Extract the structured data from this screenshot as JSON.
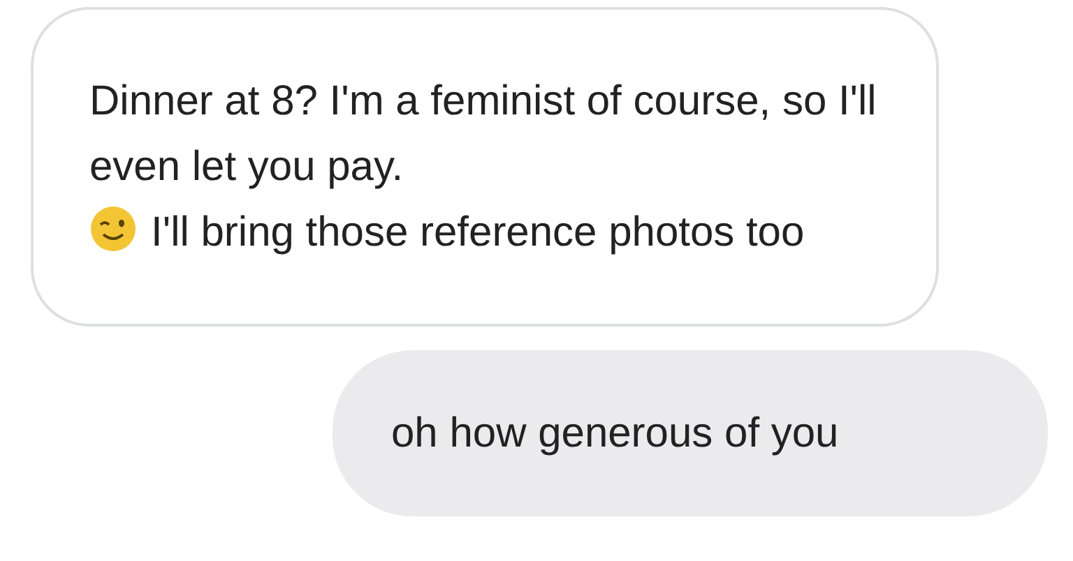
{
  "messages": [
    {
      "kind": "received",
      "segments": [
        {
          "kind": "text",
          "text": "Dinner at 8? I'm a feminist of course, so I'll even let you pay."
        },
        {
          "kind": "emoji"
        },
        {
          "kind": "text",
          "text": "I'll bring those reference photos too"
        }
      ]
    },
    {
      "kind": "sent",
      "segments": [
        {
          "kind": "text",
          "text": "oh how generous of you"
        }
      ]
    }
  ]
}
